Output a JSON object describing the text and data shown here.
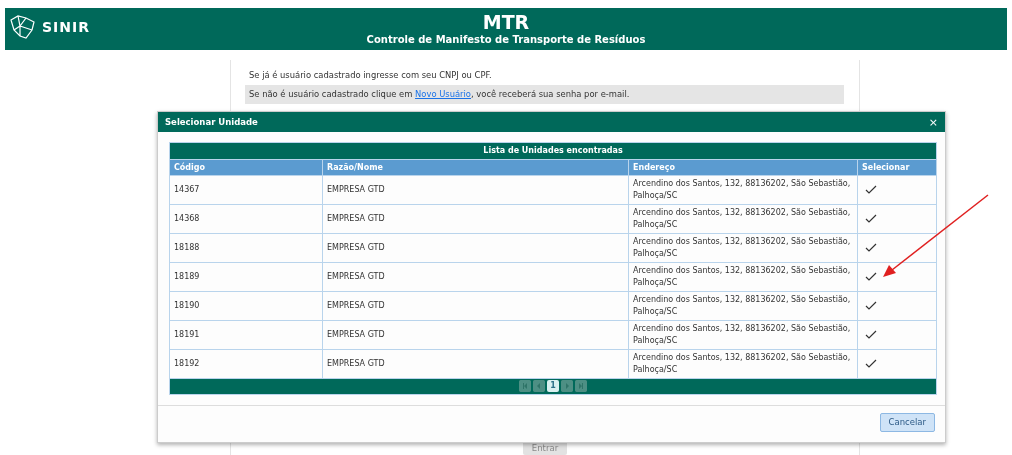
{
  "header": {
    "logo_text": "SINIR",
    "title": "MTR",
    "subtitle": "Controle de Manifesto de Transporte de Resíduos"
  },
  "login_panel": {
    "line_1": "Se já é usuário cadastrado ingresse com seu CNPJ ou CPF.",
    "line_2_before": "Se não é usuário cadastrado clique em ",
    "line_2_link": "Novo Usuário",
    "line_2_after": ", você receberá sua senha por e-mail.",
    "submit_button": {
      "label": "Entrar",
      "disabled": true
    }
  },
  "modal": {
    "title": "Selecionar Unidade",
    "close": "×",
    "table": {
      "caption": "Lista de Unidades encontradas",
      "columns": [
        "Código",
        "Razão/Nome",
        "Endereço",
        "Selecionar"
      ],
      "rows": [
        {
          "code": "14367",
          "name": "EMPRESA GTD",
          "address": "Arcendino dos Santos, 132, 88136202, São Sebastião, Palhoça/SC"
        },
        {
          "code": "14368",
          "name": "EMPRESA GTD",
          "address": "Arcendino dos Santos, 132, 88136202, São Sebastião, Palhoça/SC"
        },
        {
          "code": "18188",
          "name": "EMPRESA GTD",
          "address": "Arcendino dos Santos, 132, 88136202, São Sebastião, Palhoça/SC"
        },
        {
          "code": "18189",
          "name": "EMPRESA GTD",
          "address": "Arcendino dos Santos, 132, 88136202, São Sebastião, Palhoça/SC"
        },
        {
          "code": "18190",
          "name": "EMPRESA GTD",
          "address": "Arcendino dos Santos, 132, 88136202, São Sebastião, Palhoça/SC"
        },
        {
          "code": "18191",
          "name": "EMPRESA GTD",
          "address": "Arcendino dos Santos, 132, 88136202, São Sebastião, Palhoça/SC"
        },
        {
          "code": "18192",
          "name": "EMPRESA GTD",
          "address": "Arcendino dos Santos, 132, 88136202, São Sebastião, Palhoça/SC"
        }
      ],
      "pages": [
        {
          "label": "1",
          "selected": true
        }
      ]
    },
    "cancel_button": "Cancelar"
  }
}
